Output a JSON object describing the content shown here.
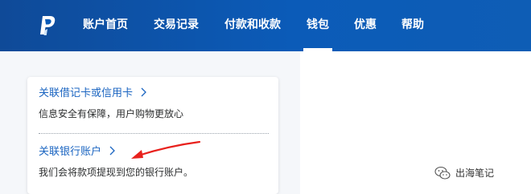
{
  "nav": {
    "logo": "paypal-logo-icon",
    "items": [
      "账户首页",
      "交易记录",
      "付款和收款",
      "钱包",
      "优惠",
      "帮助"
    ],
    "active_index": 3
  },
  "card": {
    "link_card": "关联借记卡或信用卡",
    "link_card_desc": "信息安全有保障，用户购物更放心",
    "link_bank": "关联银行账户",
    "link_bank_desc": "我们会将款项提现到您的银行账户。",
    "chevron_icon": "chevron-right-icon"
  },
  "annotation": {
    "arrow_icon": "red-arrow-icon",
    "arrow_color": "#e8211d"
  },
  "watermark": {
    "text": "出海笔记",
    "icon": "wechat-icon"
  },
  "colors": {
    "nav_bg": "#0b5bb8",
    "link": "#1b65c1"
  }
}
